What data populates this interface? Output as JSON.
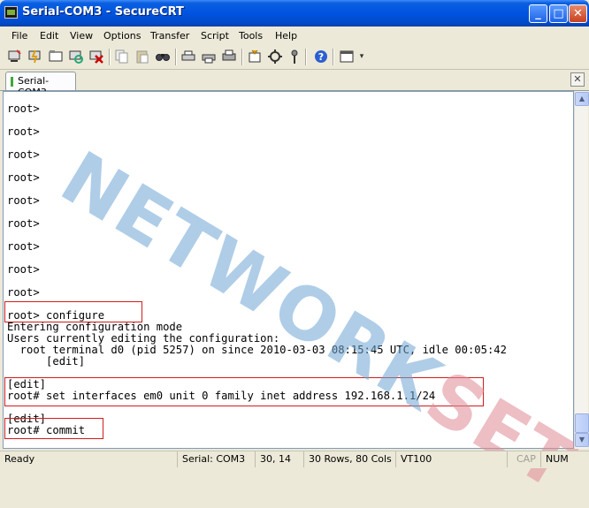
{
  "window": {
    "title": "Serial-COM3 - SecureCRT",
    "minimize": "_",
    "maximize": "□",
    "close": "✕"
  },
  "menu": [
    "File",
    "Edit",
    "View",
    "Options",
    "Transfer",
    "Script",
    "Tools",
    "Help"
  ],
  "toolbar": {
    "icons": [
      "connect-icon",
      "quick-connect-icon",
      "connect-tab-icon",
      "reconnect-icon",
      "disconnect-icon",
      "copy-icon",
      "paste-icon",
      "find-icon",
      "print-setup-icon",
      "print-icon",
      "print-screen-icon",
      "session-options-icon",
      "global-options-icon",
      "keymap-icon",
      "help-icon",
      "chat-window-icon"
    ]
  },
  "tab": {
    "label": "Serial-COM3",
    "close": "✕"
  },
  "terminal": {
    "lines": [
      "root>",
      "root>",
      "root>",
      "root>",
      "root>",
      "root>",
      "root>",
      "root>",
      "root>",
      "root> configure",
      "Entering configuration mode",
      "Users currently editing the configuration:",
      "  root terminal d0 (pid 5257) on since 2010-03-03 08:15:45 UTC, idle 00:05:42",
      "      [edit]",
      "[edit]",
      "root# set interfaces em0 unit 0 family inet address 192.168.1.1/24",
      "[edit]",
      "root# commit"
    ]
  },
  "watermark": {
    "part1": "NETWORK",
    "part2": "SET"
  },
  "colors": {
    "highlight": "#d01c1c",
    "titlebar": "#0053e0"
  },
  "status": {
    "ready": "Ready",
    "connection": "Serial: COM3",
    "cursor": "30, 14",
    "size": "30 Rows, 80 Cols",
    "emulation": "VT100",
    "cap": "CAP",
    "num": "NUM"
  }
}
